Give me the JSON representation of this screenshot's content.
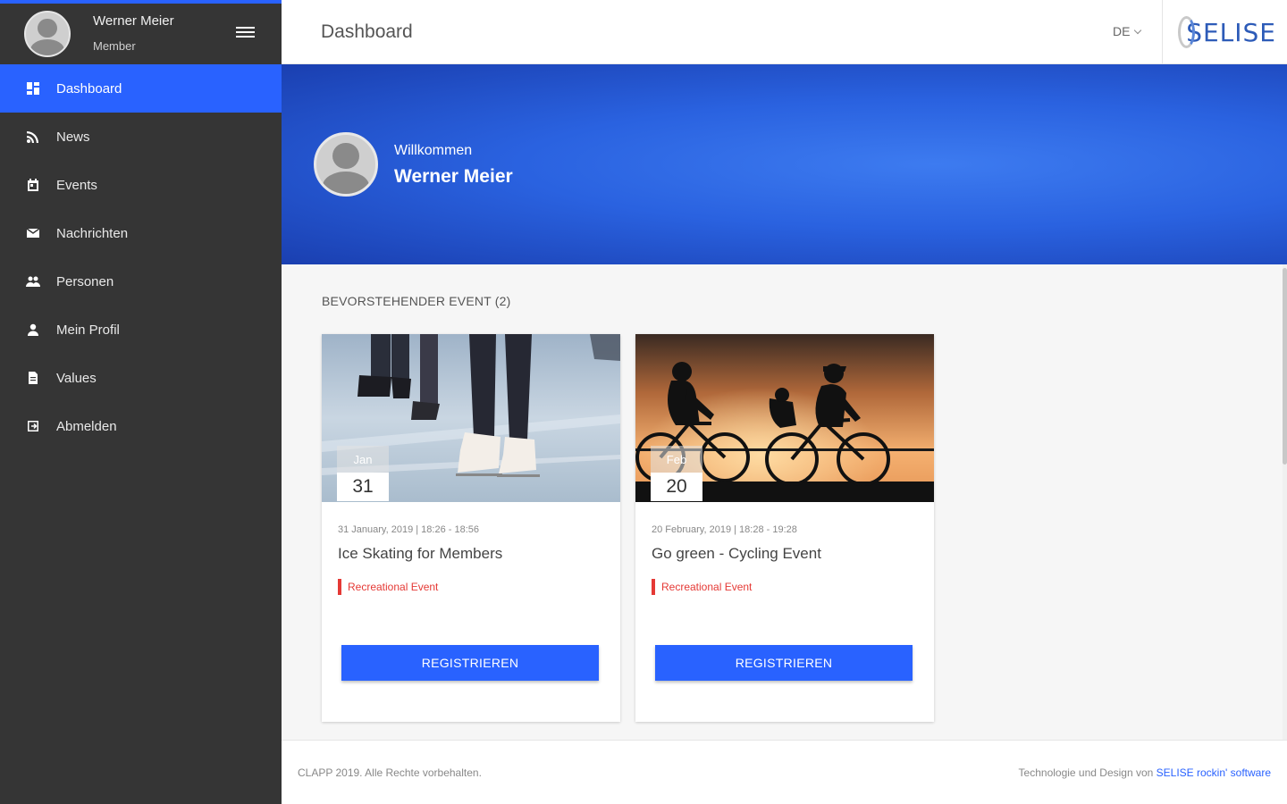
{
  "sidebar": {
    "user": {
      "name": "Werner Meier",
      "role": "Member"
    },
    "items": [
      {
        "label": "Dashboard",
        "icon": "dashboard-icon",
        "active": true
      },
      {
        "label": "News",
        "icon": "rss-icon"
      },
      {
        "label": "Events",
        "icon": "calendar-icon"
      },
      {
        "label": "Nachrichten",
        "icon": "message-icon"
      },
      {
        "label": "Personen",
        "icon": "people-icon"
      },
      {
        "label": "Mein Profil",
        "icon": "person-icon"
      },
      {
        "label": "Values",
        "icon": "document-icon"
      },
      {
        "label": "Abmelden",
        "icon": "logout-icon"
      }
    ]
  },
  "header": {
    "title": "Dashboard",
    "language": "DE",
    "logo_text": "SELISE"
  },
  "hero": {
    "greeting": "Willkommen",
    "name": "Werner Meier"
  },
  "events": {
    "section_title": "BEVORSTEHENDER EVENT (2)",
    "cards": [
      {
        "month": "Jan",
        "day": "31",
        "meta": "31 January, 2019 | 18:26 - 18:56",
        "title": "Ice Skating for Members",
        "tag": "Recreational Event",
        "button": "REGISTRIEREN"
      },
      {
        "month": "Feb",
        "day": "20",
        "meta": "20 February, 2019 | 18:28 - 19:28",
        "title": "Go green - Cycling Event",
        "tag": "Recreational Event",
        "button": "REGISTRIEREN"
      }
    ]
  },
  "footer": {
    "copyright": "CLAPP 2019. Alle Rechte vorbehalten.",
    "credit_prefix": "Technologie und Design von ",
    "credit_link": "SELISE rockin' software"
  },
  "colors": {
    "accent": "#2962ff",
    "sidebar_bg": "#353535",
    "tag_red": "#e53935"
  }
}
